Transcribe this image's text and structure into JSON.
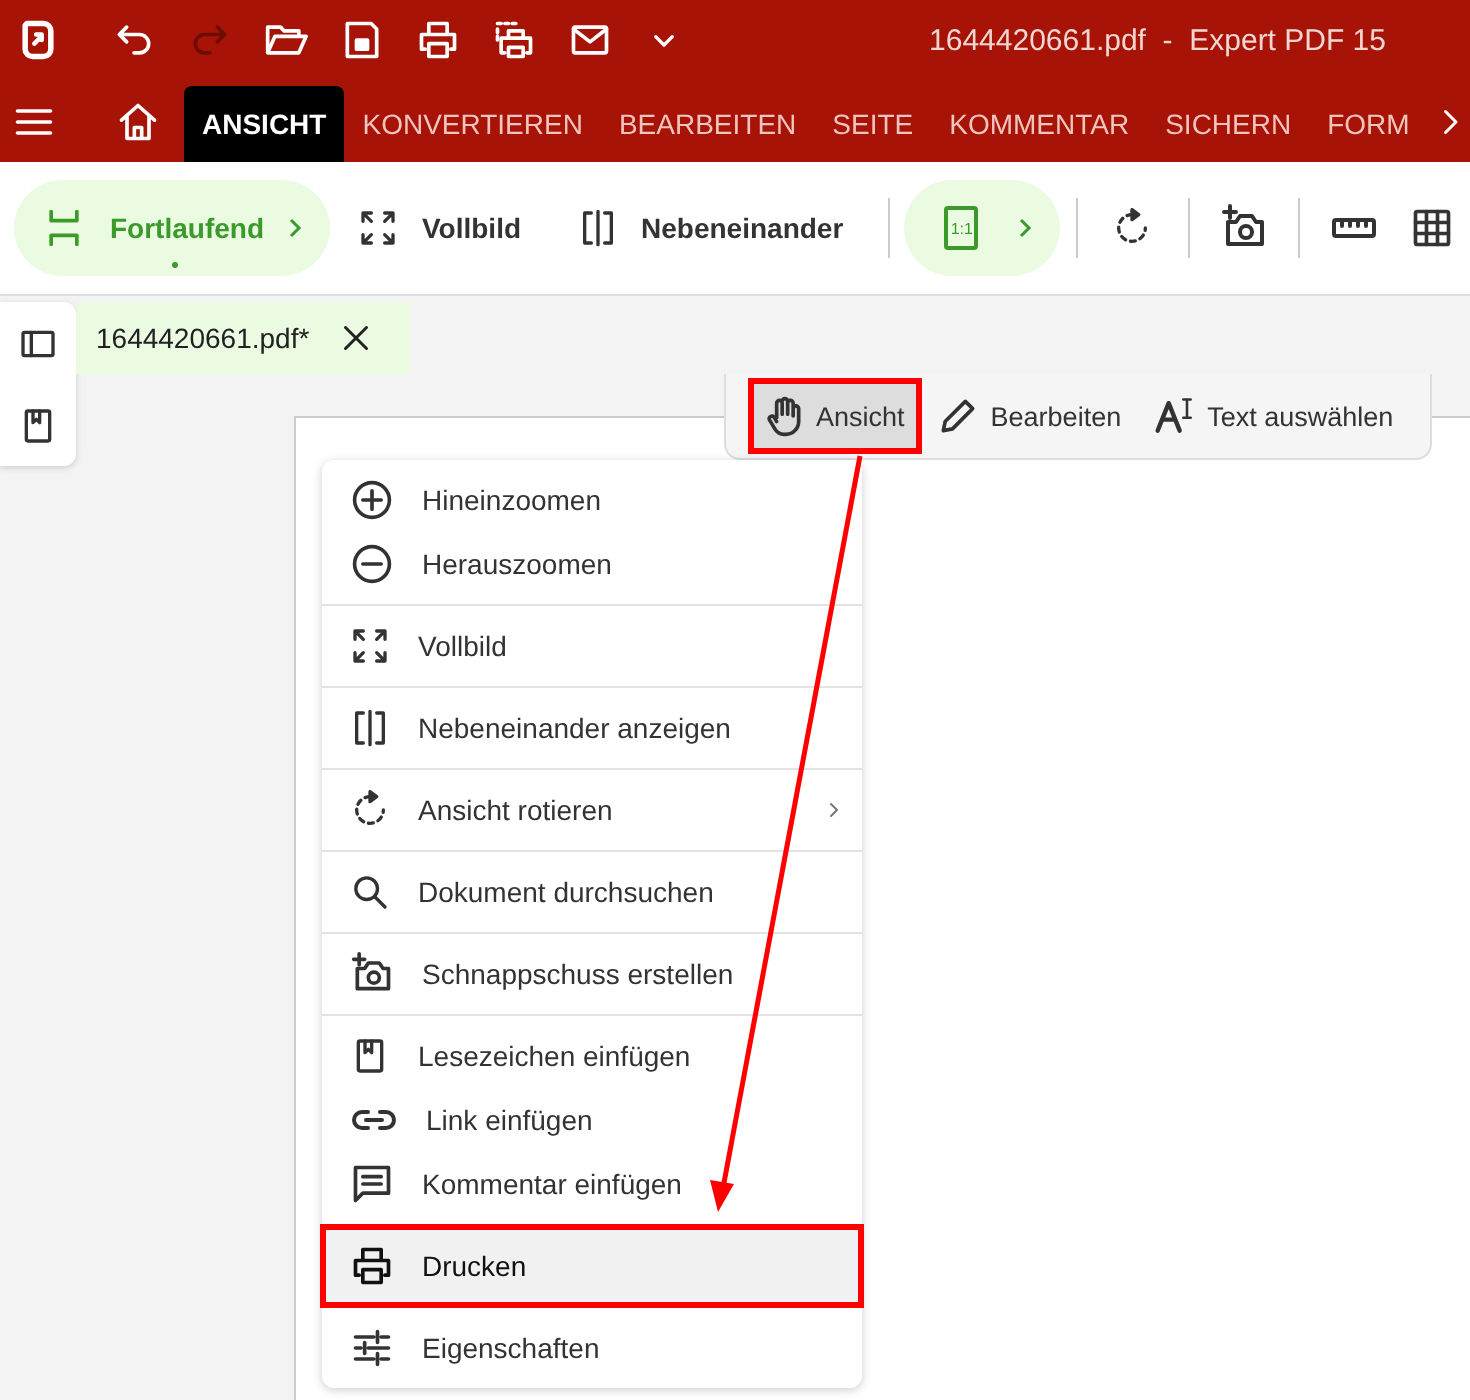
{
  "title_bar": {
    "title": "1644420661.pdf  -  Expert PDF 15"
  },
  "ribbon": {
    "tabs": [
      {
        "label": "ANSICHT",
        "selected": true
      },
      {
        "label": "KONVERTIEREN",
        "selected": false
      },
      {
        "label": "BEARBEITEN",
        "selected": false
      },
      {
        "label": "SEITE",
        "selected": false
      },
      {
        "label": "KOMMENTAR",
        "selected": false
      },
      {
        "label": "SICHERN",
        "selected": false
      },
      {
        "label": "FORM",
        "selected": false
      }
    ]
  },
  "toolbar": {
    "items": [
      {
        "label": "Fortlaufend",
        "selected": true
      },
      {
        "label": "Vollbild",
        "selected": false
      },
      {
        "label": "Nebeneinander",
        "selected": false
      },
      {
        "label": "1:1",
        "selected": true
      }
    ]
  },
  "document_tab": {
    "label": "1644420661.pdf*"
  },
  "mode_toolbar": {
    "items": [
      {
        "label": "Ansicht",
        "selected": true,
        "callout": true
      },
      {
        "label": "Bearbeiten",
        "selected": false,
        "callout": false
      },
      {
        "label": "Text auswählen",
        "selected": false,
        "callout": false
      }
    ]
  },
  "context_menu": {
    "groups": [
      {
        "items": [
          {
            "label": "Hineinzoomen",
            "selected": false,
            "submenu": false,
            "callout": false
          },
          {
            "label": "Herauszoomen",
            "selected": false,
            "submenu": false,
            "callout": false
          }
        ]
      },
      {
        "items": [
          {
            "label": "Vollbild",
            "selected": false,
            "submenu": false,
            "callout": false
          }
        ]
      },
      {
        "items": [
          {
            "label": "Nebeneinander anzeigen",
            "selected": false,
            "submenu": false,
            "callout": false
          }
        ]
      },
      {
        "items": [
          {
            "label": "Ansicht rotieren",
            "selected": false,
            "submenu": true,
            "callout": false
          }
        ]
      },
      {
        "items": [
          {
            "label": "Dokument durchsuchen",
            "selected": false,
            "submenu": false,
            "callout": false
          }
        ]
      },
      {
        "items": [
          {
            "label": "Schnappschuss erstellen",
            "selected": false,
            "submenu": false,
            "callout": false
          }
        ]
      },
      {
        "items": [
          {
            "label": "Lesezeichen einfügen",
            "selected": false,
            "submenu": false,
            "callout": false
          },
          {
            "label": "Link einfügen",
            "selected": false,
            "submenu": false,
            "callout": false
          },
          {
            "label": "Kommentar einfügen",
            "selected": false,
            "submenu": false,
            "callout": false
          }
        ]
      },
      {
        "items": [
          {
            "label": "Drucken",
            "selected": true,
            "submenu": false,
            "callout": true
          }
        ]
      },
      {
        "items": [
          {
            "label": "Eigenschaften",
            "selected": false,
            "submenu": false,
            "callout": false
          }
        ]
      }
    ]
  }
}
